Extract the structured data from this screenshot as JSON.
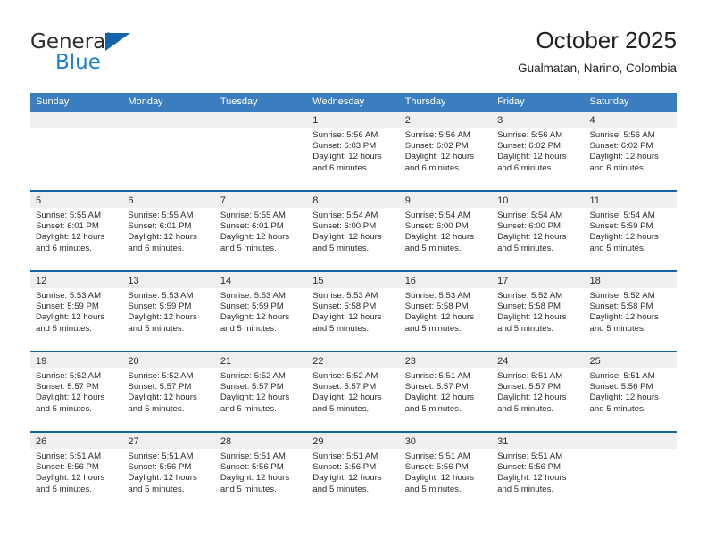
{
  "brand": {
    "name_part1": "General",
    "name_part2": "Blue",
    "triangle_icon": "triangle-icon"
  },
  "header": {
    "title": "October 2025",
    "location": "Gualmatan, Narino, Colombia"
  },
  "theme": {
    "header_blue": "#3a7ebf",
    "rule_blue": "#1464ad",
    "day_strip_gray": "#efefef",
    "brand_blue": "#1b7fd4",
    "text": "#2b2b2b"
  },
  "weekdays": [
    "Sunday",
    "Monday",
    "Tuesday",
    "Wednesday",
    "Thursday",
    "Friday",
    "Saturday"
  ],
  "weeks": [
    [
      {
        "day": "",
        "empty": true,
        "sunrise": "",
        "sunset": "",
        "daylight_line1": "",
        "daylight_line2": ""
      },
      {
        "day": "",
        "empty": true,
        "sunrise": "",
        "sunset": "",
        "daylight_line1": "",
        "daylight_line2": ""
      },
      {
        "day": "",
        "empty": true,
        "sunrise": "",
        "sunset": "",
        "daylight_line1": "",
        "daylight_line2": ""
      },
      {
        "day": "1",
        "empty": false,
        "sunrise": "Sunrise: 5:56 AM",
        "sunset": "Sunset: 6:03 PM",
        "daylight_line1": "Daylight: 12 hours",
        "daylight_line2": "and 6 minutes."
      },
      {
        "day": "2",
        "empty": false,
        "sunrise": "Sunrise: 5:56 AM",
        "sunset": "Sunset: 6:02 PM",
        "daylight_line1": "Daylight: 12 hours",
        "daylight_line2": "and 6 minutes."
      },
      {
        "day": "3",
        "empty": false,
        "sunrise": "Sunrise: 5:56 AM",
        "sunset": "Sunset: 6:02 PM",
        "daylight_line1": "Daylight: 12 hours",
        "daylight_line2": "and 6 minutes."
      },
      {
        "day": "4",
        "empty": false,
        "sunrise": "Sunrise: 5:56 AM",
        "sunset": "Sunset: 6:02 PM",
        "daylight_line1": "Daylight: 12 hours",
        "daylight_line2": "and 6 minutes."
      }
    ],
    [
      {
        "day": "5",
        "empty": false,
        "sunrise": "Sunrise: 5:55 AM",
        "sunset": "Sunset: 6:01 PM",
        "daylight_line1": "Daylight: 12 hours",
        "daylight_line2": "and 6 minutes."
      },
      {
        "day": "6",
        "empty": false,
        "sunrise": "Sunrise: 5:55 AM",
        "sunset": "Sunset: 6:01 PM",
        "daylight_line1": "Daylight: 12 hours",
        "daylight_line2": "and 6 minutes."
      },
      {
        "day": "7",
        "empty": false,
        "sunrise": "Sunrise: 5:55 AM",
        "sunset": "Sunset: 6:01 PM",
        "daylight_line1": "Daylight: 12 hours",
        "daylight_line2": "and 5 minutes."
      },
      {
        "day": "8",
        "empty": false,
        "sunrise": "Sunrise: 5:54 AM",
        "sunset": "Sunset: 6:00 PM",
        "daylight_line1": "Daylight: 12 hours",
        "daylight_line2": "and 5 minutes."
      },
      {
        "day": "9",
        "empty": false,
        "sunrise": "Sunrise: 5:54 AM",
        "sunset": "Sunset: 6:00 PM",
        "daylight_line1": "Daylight: 12 hours",
        "daylight_line2": "and 5 minutes."
      },
      {
        "day": "10",
        "empty": false,
        "sunrise": "Sunrise: 5:54 AM",
        "sunset": "Sunset: 6:00 PM",
        "daylight_line1": "Daylight: 12 hours",
        "daylight_line2": "and 5 minutes."
      },
      {
        "day": "11",
        "empty": false,
        "sunrise": "Sunrise: 5:54 AM",
        "sunset": "Sunset: 5:59 PM",
        "daylight_line1": "Daylight: 12 hours",
        "daylight_line2": "and 5 minutes."
      }
    ],
    [
      {
        "day": "12",
        "empty": false,
        "sunrise": "Sunrise: 5:53 AM",
        "sunset": "Sunset: 5:59 PM",
        "daylight_line1": "Daylight: 12 hours",
        "daylight_line2": "and 5 minutes."
      },
      {
        "day": "13",
        "empty": false,
        "sunrise": "Sunrise: 5:53 AM",
        "sunset": "Sunset: 5:59 PM",
        "daylight_line1": "Daylight: 12 hours",
        "daylight_line2": "and 5 minutes."
      },
      {
        "day": "14",
        "empty": false,
        "sunrise": "Sunrise: 5:53 AM",
        "sunset": "Sunset: 5:59 PM",
        "daylight_line1": "Daylight: 12 hours",
        "daylight_line2": "and 5 minutes."
      },
      {
        "day": "15",
        "empty": false,
        "sunrise": "Sunrise: 5:53 AM",
        "sunset": "Sunset: 5:58 PM",
        "daylight_line1": "Daylight: 12 hours",
        "daylight_line2": "and 5 minutes."
      },
      {
        "day": "16",
        "empty": false,
        "sunrise": "Sunrise: 5:53 AM",
        "sunset": "Sunset: 5:58 PM",
        "daylight_line1": "Daylight: 12 hours",
        "daylight_line2": "and 5 minutes."
      },
      {
        "day": "17",
        "empty": false,
        "sunrise": "Sunrise: 5:52 AM",
        "sunset": "Sunset: 5:58 PM",
        "daylight_line1": "Daylight: 12 hours",
        "daylight_line2": "and 5 minutes."
      },
      {
        "day": "18",
        "empty": false,
        "sunrise": "Sunrise: 5:52 AM",
        "sunset": "Sunset: 5:58 PM",
        "daylight_line1": "Daylight: 12 hours",
        "daylight_line2": "and 5 minutes."
      }
    ],
    [
      {
        "day": "19",
        "empty": false,
        "sunrise": "Sunrise: 5:52 AM",
        "sunset": "Sunset: 5:57 PM",
        "daylight_line1": "Daylight: 12 hours",
        "daylight_line2": "and 5 minutes."
      },
      {
        "day": "20",
        "empty": false,
        "sunrise": "Sunrise: 5:52 AM",
        "sunset": "Sunset: 5:57 PM",
        "daylight_line1": "Daylight: 12 hours",
        "daylight_line2": "and 5 minutes."
      },
      {
        "day": "21",
        "empty": false,
        "sunrise": "Sunrise: 5:52 AM",
        "sunset": "Sunset: 5:57 PM",
        "daylight_line1": "Daylight: 12 hours",
        "daylight_line2": "and 5 minutes."
      },
      {
        "day": "22",
        "empty": false,
        "sunrise": "Sunrise: 5:52 AM",
        "sunset": "Sunset: 5:57 PM",
        "daylight_line1": "Daylight: 12 hours",
        "daylight_line2": "and 5 minutes."
      },
      {
        "day": "23",
        "empty": false,
        "sunrise": "Sunrise: 5:51 AM",
        "sunset": "Sunset: 5:57 PM",
        "daylight_line1": "Daylight: 12 hours",
        "daylight_line2": "and 5 minutes."
      },
      {
        "day": "24",
        "empty": false,
        "sunrise": "Sunrise: 5:51 AM",
        "sunset": "Sunset: 5:57 PM",
        "daylight_line1": "Daylight: 12 hours",
        "daylight_line2": "and 5 minutes."
      },
      {
        "day": "25",
        "empty": false,
        "sunrise": "Sunrise: 5:51 AM",
        "sunset": "Sunset: 5:56 PM",
        "daylight_line1": "Daylight: 12 hours",
        "daylight_line2": "and 5 minutes."
      }
    ],
    [
      {
        "day": "26",
        "empty": false,
        "sunrise": "Sunrise: 5:51 AM",
        "sunset": "Sunset: 5:56 PM",
        "daylight_line1": "Daylight: 12 hours",
        "daylight_line2": "and 5 minutes."
      },
      {
        "day": "27",
        "empty": false,
        "sunrise": "Sunrise: 5:51 AM",
        "sunset": "Sunset: 5:56 PM",
        "daylight_line1": "Daylight: 12 hours",
        "daylight_line2": "and 5 minutes."
      },
      {
        "day": "28",
        "empty": false,
        "sunrise": "Sunrise: 5:51 AM",
        "sunset": "Sunset: 5:56 PM",
        "daylight_line1": "Daylight: 12 hours",
        "daylight_line2": "and 5 minutes."
      },
      {
        "day": "29",
        "empty": false,
        "sunrise": "Sunrise: 5:51 AM",
        "sunset": "Sunset: 5:56 PM",
        "daylight_line1": "Daylight: 12 hours",
        "daylight_line2": "and 5 minutes."
      },
      {
        "day": "30",
        "empty": false,
        "sunrise": "Sunrise: 5:51 AM",
        "sunset": "Sunset: 5:56 PM",
        "daylight_line1": "Daylight: 12 hours",
        "daylight_line2": "and 5 minutes."
      },
      {
        "day": "31",
        "empty": false,
        "sunrise": "Sunrise: 5:51 AM",
        "sunset": "Sunset: 5:56 PM",
        "daylight_line1": "Daylight: 12 hours",
        "daylight_line2": "and 5 minutes."
      },
      {
        "day": "",
        "empty": true,
        "sunrise": "",
        "sunset": "",
        "daylight_line1": "",
        "daylight_line2": ""
      }
    ]
  ]
}
